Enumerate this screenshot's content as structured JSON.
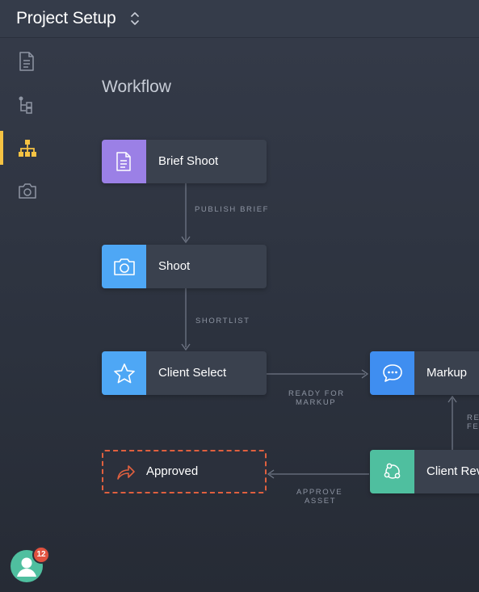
{
  "header": {
    "title": "Project Setup",
    "switcher_icon": "chevron-up-down-icon"
  },
  "sidebar": {
    "items": [
      {
        "icon": "document-icon",
        "active": false
      },
      {
        "icon": "tree-structure-icon",
        "active": false
      },
      {
        "icon": "workflow-hierarchy-icon",
        "active": true
      },
      {
        "icon": "camera-icon",
        "active": false
      }
    ]
  },
  "user": {
    "notifications": "12"
  },
  "workflow": {
    "title": "Workflow",
    "nodes": {
      "brief_shoot": {
        "label": "Brief Shoot",
        "icon": "document-icon",
        "color": "#9b80e6"
      },
      "shoot": {
        "label": "Shoot",
        "icon": "camera-icon",
        "color": "#4ea7f5"
      },
      "client_select": {
        "label": "Client Select",
        "icon": "star-icon",
        "color": "#4ea7f5"
      },
      "markup": {
        "label": "Markup",
        "icon": "chat-bubble-icon",
        "color": "#3f8ef0"
      },
      "client_review": {
        "label": "Client Rev",
        "icon": "share-nodes-icon",
        "color": "#4fbf9f"
      },
      "approved": {
        "label": "Approved",
        "icon": "share-arrow-icon",
        "color": "#e0603f"
      }
    },
    "edges": {
      "publish_brief": "PUBLISH BRIEF",
      "shortlist": "SHORTLIST",
      "ready_for_markup_1": "READY FOR",
      "ready_for_markup_2": "MARKUP",
      "approve_asset_1": "APPROVE",
      "approve_asset_2": "ASSET",
      "partial_1": "RE",
      "partial_2": "FE"
    }
  },
  "colors": {
    "accent": "#f6c343",
    "badge": "#e1523f"
  }
}
